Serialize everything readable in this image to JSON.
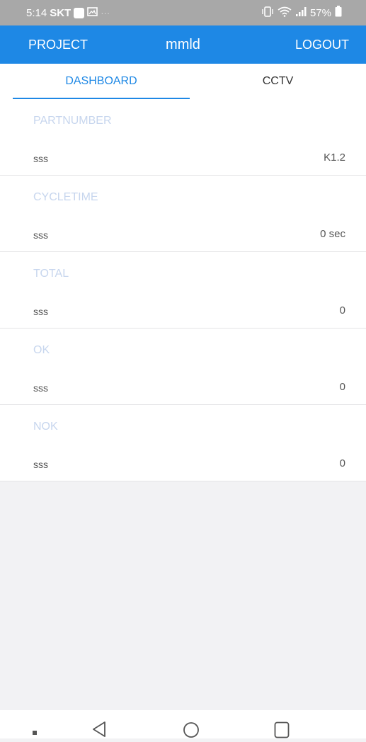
{
  "status_bar": {
    "time": "5:14",
    "carrier": "SKT",
    "signal_dots": "···",
    "battery_percent": "57%",
    "icons": [
      "vibrate-icon",
      "wifi-icon",
      "signal-icon",
      "battery-icon",
      "gallery-icon"
    ]
  },
  "app_bar": {
    "project_label": "PROJECT",
    "title": "mmld",
    "logout_label": "LOGOUT"
  },
  "tabs": [
    {
      "label": "DASHBOARD",
      "active": true
    },
    {
      "label": "CCTV",
      "active": false
    }
  ],
  "sections": [
    {
      "header": "PARTNUMBER",
      "label": "sss",
      "value": "K1.2"
    },
    {
      "header": "CYCLETIME",
      "label": "sss",
      "value": "0 sec"
    },
    {
      "header": "TOTAL",
      "label": "sss",
      "value": "0"
    },
    {
      "header": "OK",
      "label": "sss",
      "value": "0"
    },
    {
      "header": "NOK",
      "label": "sss",
      "value": "0"
    }
  ],
  "colors": {
    "accent": "#1e88e5",
    "section_header": "#c7d6ee",
    "status_bar": "#a8a8a8"
  },
  "nav_bar": {
    "icons": [
      "menu-dot-icon",
      "back-icon",
      "home-icon",
      "recents-icon"
    ]
  }
}
